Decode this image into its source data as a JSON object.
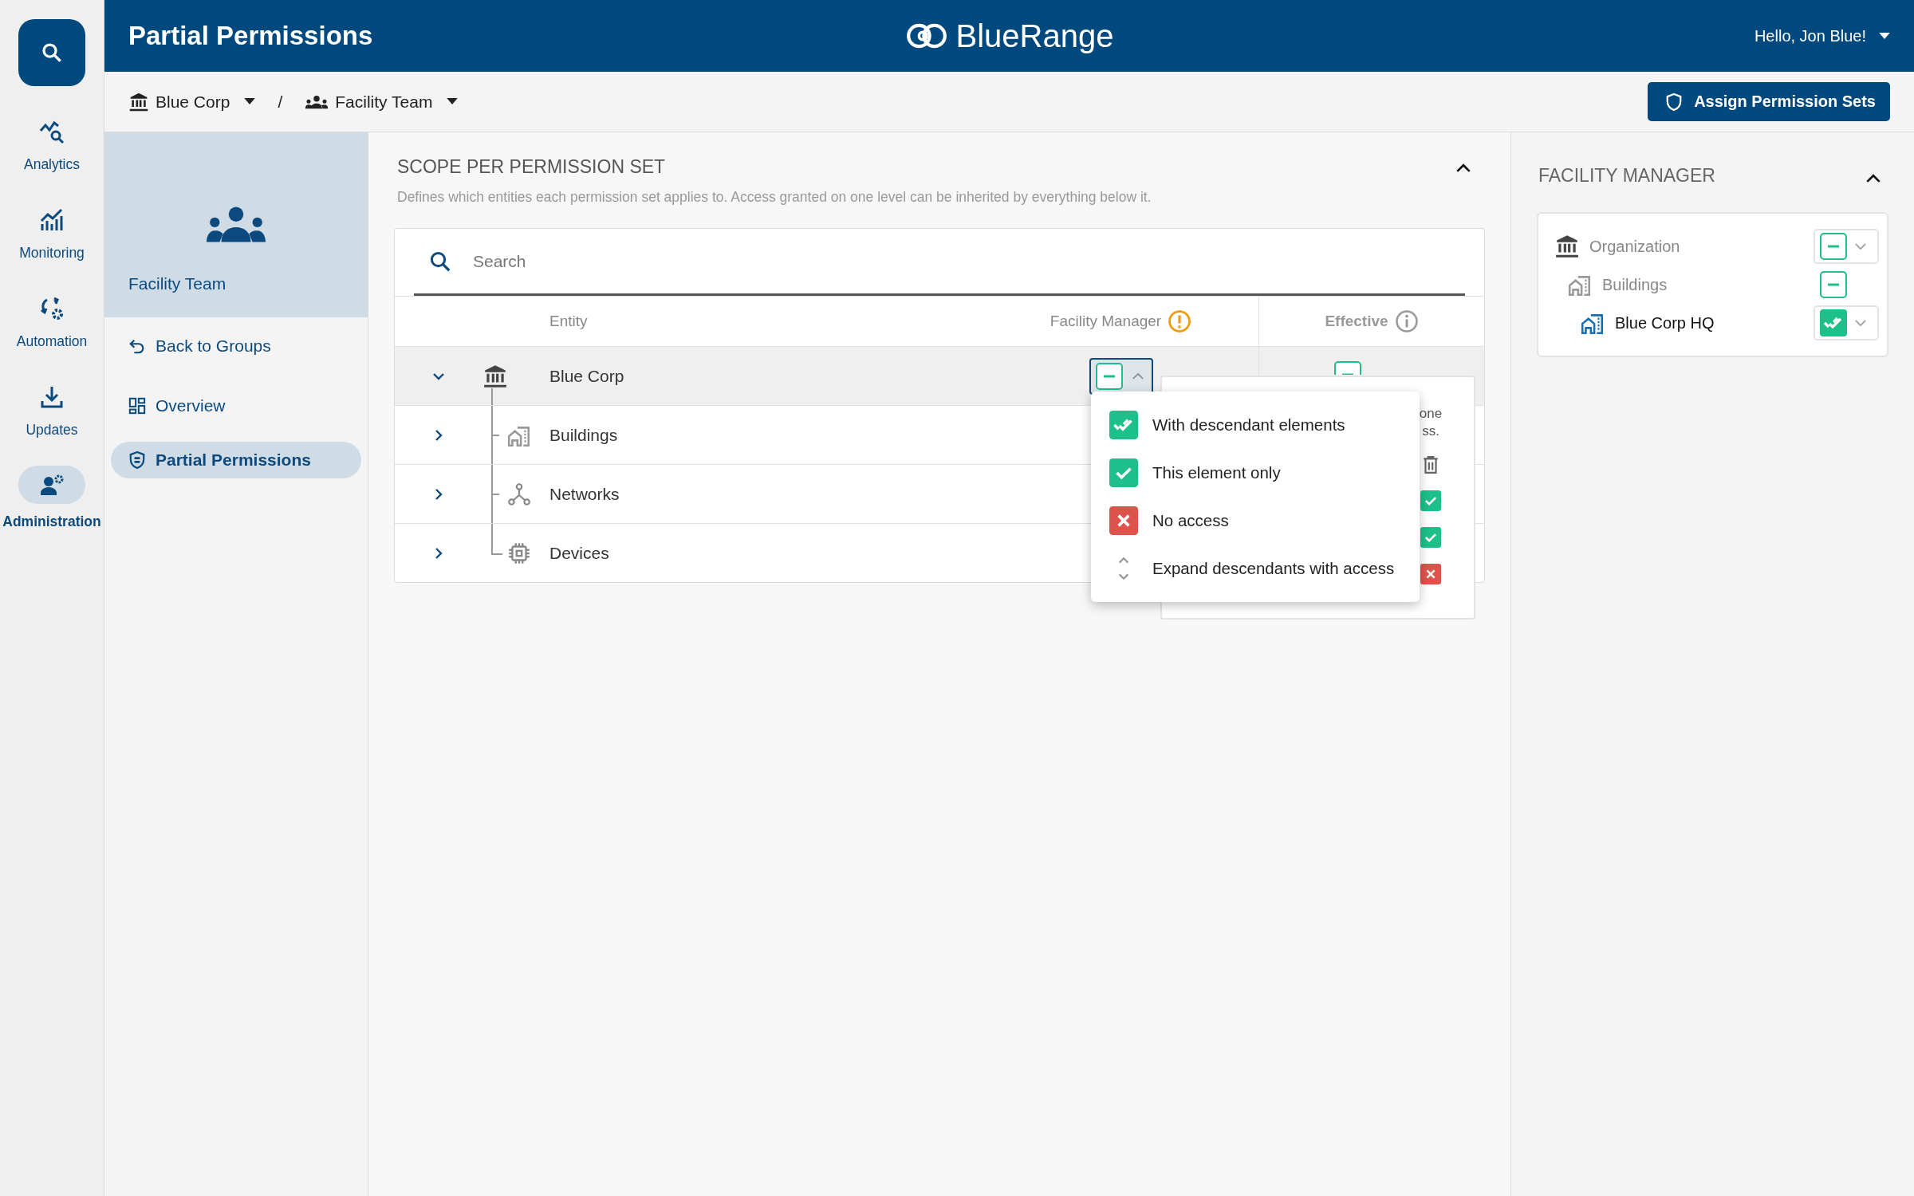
{
  "header": {
    "title": "Partial Permissions",
    "logo_text": "BlueRange",
    "user": "Hello, Jon Blue!"
  },
  "rail": {
    "items": [
      {
        "label": "Analytics",
        "kind": "analytics",
        "selected": false
      },
      {
        "label": "Monitoring",
        "kind": "monitoring",
        "selected": false
      },
      {
        "label": "Automation",
        "kind": "automation",
        "selected": false
      },
      {
        "label": "Updates",
        "kind": "updates",
        "selected": false
      },
      {
        "label": "Administration",
        "kind": "administration",
        "selected": true
      }
    ]
  },
  "breadcrumb": {
    "items": [
      {
        "label": "Blue Corp",
        "kind": "organization"
      },
      {
        "label": "Facility Team",
        "kind": "group"
      }
    ],
    "separator": "/"
  },
  "assign_button": "Assign Permission Sets",
  "group_card": {
    "name": "Facility Team"
  },
  "subnav": [
    {
      "label": "Back to Groups",
      "kind": "back",
      "selected": false
    },
    {
      "label": "Overview",
      "kind": "overview",
      "selected": false
    },
    {
      "label": "Partial Permissions",
      "kind": "permissions",
      "selected": true
    }
  ],
  "scope": {
    "title": "SCOPE PER PERMISSION SET",
    "expanded": true,
    "description": "Defines which entities each permission set applies to. Access granted on one level can be inherited by everything below it.",
    "search": {
      "placeholder": "Search"
    },
    "columns": [
      "Entity",
      "Facility Manager",
      "Effective"
    ],
    "rows": [
      {
        "name": "Blue Corp",
        "kind": "organization",
        "expanded": true,
        "selected": true,
        "manager": {
          "badge": {
            "kind": "partial"
          },
          "open": true
        },
        "effective": {
          "kind": "partial"
        },
        "children": [
          {
            "name": "Buildings",
            "kind": "buildings",
            "expanded": false,
            "selected": false
          },
          {
            "name": "Networks",
            "kind": "networks",
            "expanded": false,
            "selected": false
          },
          {
            "name": "Devices",
            "kind": "devices",
            "expanded": false,
            "selected": false
          }
        ]
      }
    ],
    "menu": [
      {
        "label": "With descendant elements",
        "kind": "descendants"
      },
      {
        "label": "This element only",
        "kind": "element"
      },
      {
        "label": "No access",
        "kind": "none"
      },
      {
        "label": "Expand descendants with access",
        "kind": "expand"
      }
    ],
    "hidden_panel": {
      "lines": [
        "one",
        "ss."
      ],
      "marks": [
        {
          "kind": "element"
        },
        {
          "kind": "element"
        },
        {
          "kind": "none"
        }
      ]
    }
  },
  "right_panel": {
    "title": "FACILITY MANAGER",
    "expanded": true,
    "items": [
      {
        "name": "Organization",
        "kind": "organization",
        "badge": {
          "kind": "partial"
        },
        "dropdown": true,
        "selected": false,
        "children": [
          {
            "name": "Buildings",
            "kind": "buildings",
            "badge": {
              "kind": "partial"
            },
            "dropdown": false,
            "selected": false,
            "children": [
              {
                "name": "Blue Corp HQ",
                "kind": "buildings",
                "badge": {
                  "kind": "descendants"
                },
                "dropdown": true,
                "selected": true
              }
            ]
          }
        ]
      }
    ]
  }
}
